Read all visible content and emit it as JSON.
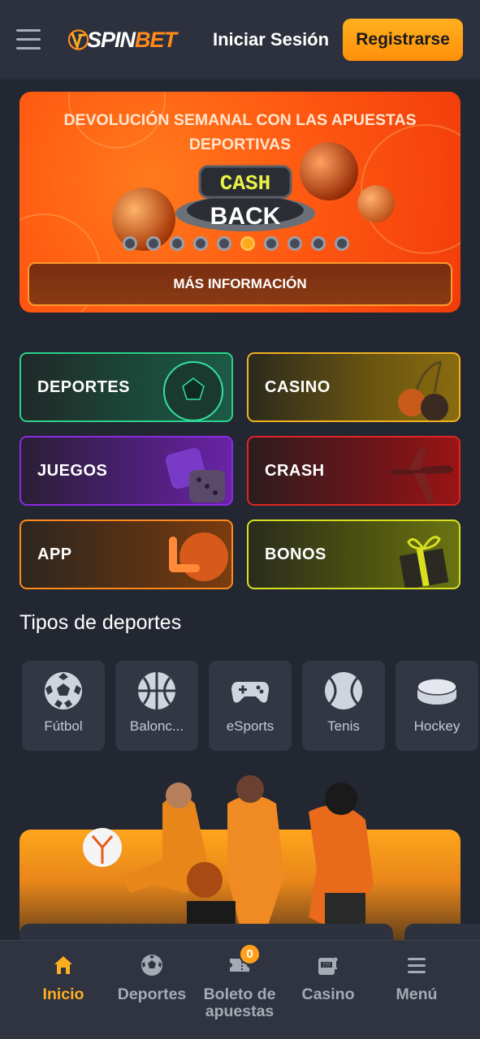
{
  "header": {
    "logo_text_a": "SPIN",
    "logo_text_b": "BET",
    "login_label": "Iniciar Sesión",
    "register_label": "Registrarse"
  },
  "banner": {
    "title": "DEVOLUCIÓN SEMANAL CON LAS APUESTAS DEPORTIVAS",
    "art_line1": "CASH",
    "art_line2": "BACK",
    "slide_count": 10,
    "active_slide": 6,
    "more_label": "MÁS INFORMACIÓN"
  },
  "categories": [
    {
      "label": "DEPORTES",
      "icon": "soccer-ball-icon"
    },
    {
      "label": "CASINO",
      "icon": "cherries-icon"
    },
    {
      "label": "JUEGOS",
      "icon": "dice-icon"
    },
    {
      "label": "CRASH",
      "icon": "airplane-icon"
    },
    {
      "label": "APP",
      "icon": "download-logo-icon"
    },
    {
      "label": "BONOS",
      "icon": "gift-box-icon"
    }
  ],
  "sports_section": {
    "title": "Tipos de deportes",
    "items": [
      {
        "label": "Fútbol",
        "icon": "soccer-icon"
      },
      {
        "label": "Balonc...",
        "icon": "basketball-icon"
      },
      {
        "label": "eSports",
        "icon": "gamepad-icon"
      },
      {
        "label": "Tenis",
        "icon": "tennis-ball-icon"
      },
      {
        "label": "Hockey",
        "icon": "hockey-puck-icon"
      }
    ]
  },
  "bottom_nav": {
    "items": [
      {
        "label": "Inicio",
        "icon": "home-icon",
        "active": true
      },
      {
        "label": "Deportes",
        "icon": "soccer-icon",
        "active": false
      },
      {
        "label": "Boleto de apuestas",
        "icon": "ticket-icon",
        "active": false
      },
      {
        "label": "Casino",
        "icon": "slot-machine-icon",
        "active": false
      },
      {
        "label": "Menú",
        "icon": "menu-icon",
        "active": false
      }
    ],
    "betslip_count": "0"
  },
  "colors": {
    "accent": "#ffae1f",
    "background": "#232732",
    "header": "#2c313d"
  }
}
